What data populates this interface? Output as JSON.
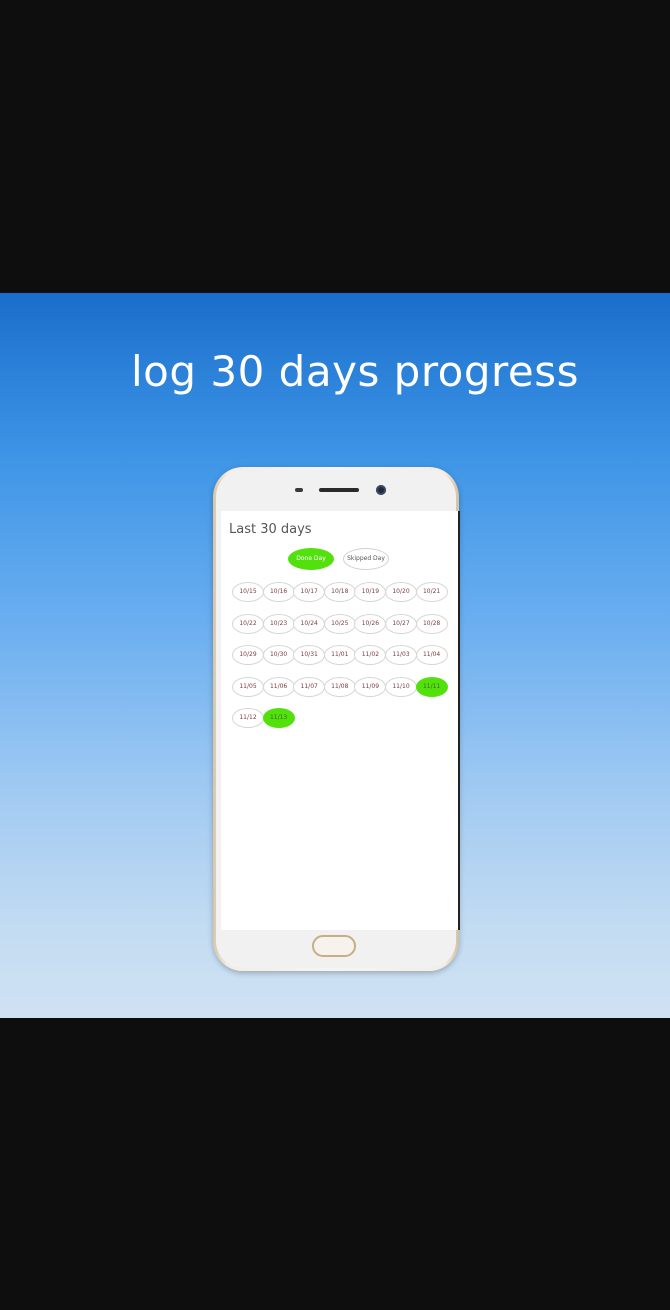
{
  "headline": "log 30 days progress",
  "app": {
    "title": "Last 30 days",
    "legend": {
      "done_label": "Done Day",
      "skipped_label": "Skipped Day"
    },
    "colors": {
      "done": "#53e10e",
      "skipped": "#ffffff"
    },
    "days": [
      {
        "label": "10/15",
        "status": "skipped"
      },
      {
        "label": "10/16",
        "status": "skipped"
      },
      {
        "label": "10/17",
        "status": "skipped"
      },
      {
        "label": "10/18",
        "status": "skipped"
      },
      {
        "label": "10/19",
        "status": "skipped"
      },
      {
        "label": "10/20",
        "status": "skipped"
      },
      {
        "label": "10/21",
        "status": "skipped"
      },
      {
        "label": "10/22",
        "status": "skipped"
      },
      {
        "label": "10/23",
        "status": "skipped"
      },
      {
        "label": "10/24",
        "status": "skipped"
      },
      {
        "label": "10/25",
        "status": "skipped"
      },
      {
        "label": "10/26",
        "status": "skipped"
      },
      {
        "label": "10/27",
        "status": "skipped"
      },
      {
        "label": "10/28",
        "status": "skipped"
      },
      {
        "label": "10/29",
        "status": "skipped"
      },
      {
        "label": "10/30",
        "status": "skipped"
      },
      {
        "label": "10/31",
        "status": "skipped"
      },
      {
        "label": "11/01",
        "status": "skipped"
      },
      {
        "label": "11/02",
        "status": "skipped"
      },
      {
        "label": "11/03",
        "status": "skipped"
      },
      {
        "label": "11/04",
        "status": "skipped"
      },
      {
        "label": "11/05",
        "status": "skipped"
      },
      {
        "label": "11/06",
        "status": "skipped"
      },
      {
        "label": "11/07",
        "status": "skipped"
      },
      {
        "label": "11/08",
        "status": "skipped"
      },
      {
        "label": "11/09",
        "status": "skipped"
      },
      {
        "label": "11/10",
        "status": "skipped"
      },
      {
        "label": "11/11",
        "status": "done"
      },
      {
        "label": "11/12",
        "status": "skipped"
      },
      {
        "label": "11/13",
        "status": "done"
      }
    ]
  }
}
